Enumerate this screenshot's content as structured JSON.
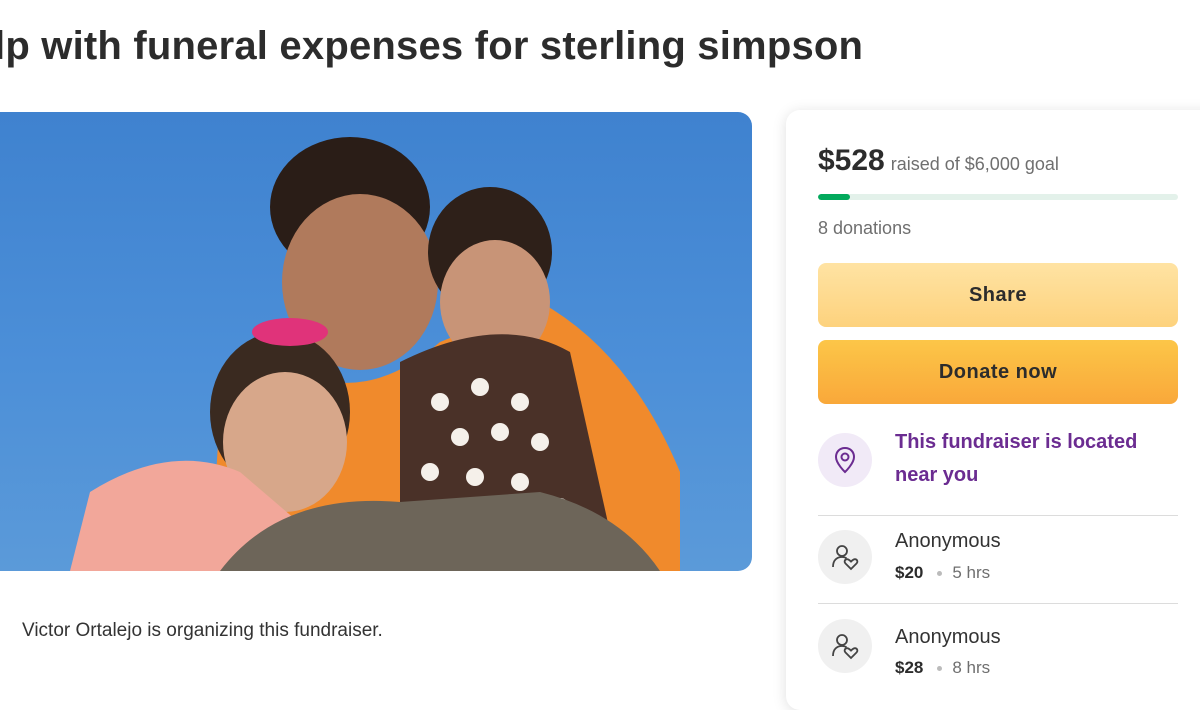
{
  "page": {
    "title": "lp with funeral expenses for sterling simpson"
  },
  "hero": {
    "alt_description": ""
  },
  "organizer": {
    "text": "Victor Ortalejo is organizing this fundraiser."
  },
  "donation_card": {
    "raised_amount": "$528",
    "raised_goal_text": "raised of $6,000 goal",
    "progress_fraction": 0.088,
    "donation_count": "8 donations",
    "share_label": "Share",
    "donate_label": "Donate now",
    "location_text": "This fundraiser is located near you",
    "location_icon": "location-pin-icon",
    "donations": [
      {
        "name": "Anonymous",
        "amount": "$20",
        "time": "5 hrs",
        "icon": "donor-heart-icon"
      },
      {
        "name": "Anonymous",
        "amount": "$28",
        "time": "8 hrs",
        "icon": "donor-heart-icon"
      }
    ]
  },
  "colors": {
    "progress_fill": "#02a95c",
    "progress_track": "#e3f1ea",
    "location_purple": "#6b2c91",
    "share_button": "#fdd27d",
    "donate_button": "#f9a83a"
  }
}
